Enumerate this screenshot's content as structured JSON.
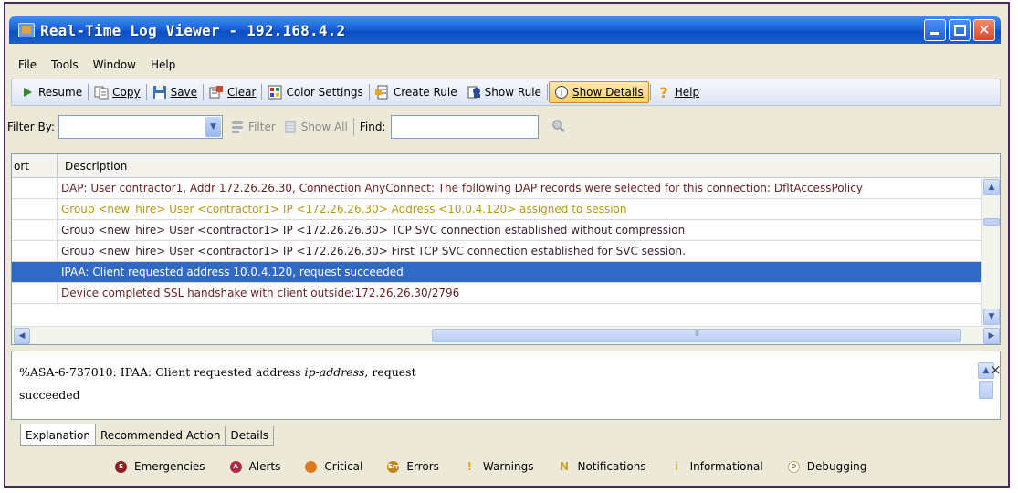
{
  "window": {
    "title": "Real-Time Log Viewer - 192.168.4.2"
  },
  "menu": [
    "File",
    "Tools",
    "Window",
    "Help"
  ],
  "toolbar": {
    "resume": "Resume",
    "copy": "Copy",
    "save": "Save",
    "clear": "Clear",
    "color_settings": "Color Settings",
    "create_rule": "Create Rule",
    "show_rule": "Show Rule",
    "show_details": "Show Details",
    "help": "Help"
  },
  "filter": {
    "label": "Filter By:",
    "value": "",
    "filter_button": "Filter",
    "show_all_button": "Show All",
    "find_label": "Find:",
    "find_value": ""
  },
  "grid": {
    "columns": [
      "ort",
      "Description"
    ],
    "rows": [
      {
        "description": "DAP: User contractor1, Addr 172.26.26.30, Connection AnyConnect: The following DAP records were selected for this connection: DfltAccessPolicy",
        "color": "#6b1f1f"
      },
      {
        "description": "Group <new_hire> User <contractor1> IP <172.26.26.30> Address <10.0.4.120> assigned to session",
        "color": "#b59a10"
      },
      {
        "description": "Group <new_hire> User <contractor1> IP <172.26.26.30> TCP SVC connection established without compression",
        "color": "#3a1e2e"
      },
      {
        "description": "Group <new_hire> User <contractor1> IP <172.26.26.30> First TCP SVC connection established for SVC session.",
        "color": "#3a1e2e"
      },
      {
        "description": "IPAA: Client requested address 10.0.4.120, request succeeded",
        "color": "#ffffff",
        "selected": true
      },
      {
        "description": "Device completed SSL handshake with client outside:172.26.26.30/2796",
        "color": "#6b1f1f"
      }
    ]
  },
  "details": {
    "line1_prefix": "%ASA-6-737010: IPAA: Client requested address ",
    "line1_var": "ip-address",
    "line1_suffix": ", request",
    "line2": "succeeded",
    "close": "×"
  },
  "tabs": [
    "Explanation",
    "Recommended Action",
    "Details"
  ],
  "active_tab": "Explanation",
  "legend": [
    {
      "label": "Emergencies",
      "color": "#8b1e1e",
      "icon": "E"
    },
    {
      "label": "Alerts",
      "color": "#b02a45",
      "icon": "A"
    },
    {
      "label": "Critical",
      "color": "#e07820",
      "icon": ""
    },
    {
      "label": "Errors",
      "color": "#c8821e",
      "icon": "Err"
    },
    {
      "label": "Warnings",
      "color": "#d6a81a",
      "icon": "!"
    },
    {
      "label": "Notifications",
      "color": "#c9a52a",
      "icon": "N"
    },
    {
      "label": "Informational",
      "color": "#d8c050",
      "icon": "i"
    },
    {
      "label": "Debugging",
      "color": "#b9a86a",
      "icon": "D"
    }
  ]
}
